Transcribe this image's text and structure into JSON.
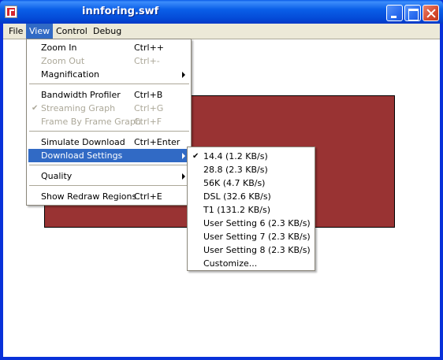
{
  "window": {
    "title": "innforing.swf"
  },
  "menubar": {
    "items": [
      {
        "label": "File"
      },
      {
        "label": "View"
      },
      {
        "label": "Control"
      },
      {
        "label": "Debug"
      }
    ]
  },
  "view_menu": {
    "items": [
      {
        "label": "Zoom In",
        "shortcut": "Ctrl++",
        "enabled": true
      },
      {
        "label": "Zoom Out",
        "shortcut": "Ctrl+-",
        "enabled": false
      },
      {
        "label": "Magnification",
        "submenu": true
      },
      {
        "label": "Bandwidth Profiler",
        "shortcut": "Ctrl+B",
        "enabled": true
      },
      {
        "label": "Streaming Graph",
        "shortcut": "Ctrl+G",
        "enabled": false,
        "checked": true
      },
      {
        "label": "Frame By Frame Graph",
        "shortcut": "Ctrl+F",
        "enabled": false
      },
      {
        "label": "Simulate Download",
        "shortcut": "Ctrl+Enter",
        "enabled": true
      },
      {
        "label": "Download Settings",
        "submenu": true,
        "highlighted": true
      },
      {
        "label": "Quality",
        "submenu": true
      },
      {
        "label": "Show Redraw Regions",
        "shortcut": "Ctrl+E",
        "enabled": true
      }
    ]
  },
  "download_settings_menu": {
    "items": [
      {
        "label": "14.4 (1.2 KB/s)",
        "checked": true
      },
      {
        "label": "28.8 (2.3 KB/s)"
      },
      {
        "label": "56K (4.7 KB/s)"
      },
      {
        "label": "DSL (32.6 KB/s)"
      },
      {
        "label": "T1 (131.2 KB/s)"
      },
      {
        "label": "User Setting 6 (2.3 KB/s)"
      },
      {
        "label": "User Setting 7 (2.3 KB/s)"
      },
      {
        "label": "User Setting 8 (2.3 KB/s)"
      },
      {
        "label": "Customize..."
      }
    ]
  },
  "stage": {
    "rect_color": "#993333"
  },
  "icons": {
    "check": "✔"
  }
}
